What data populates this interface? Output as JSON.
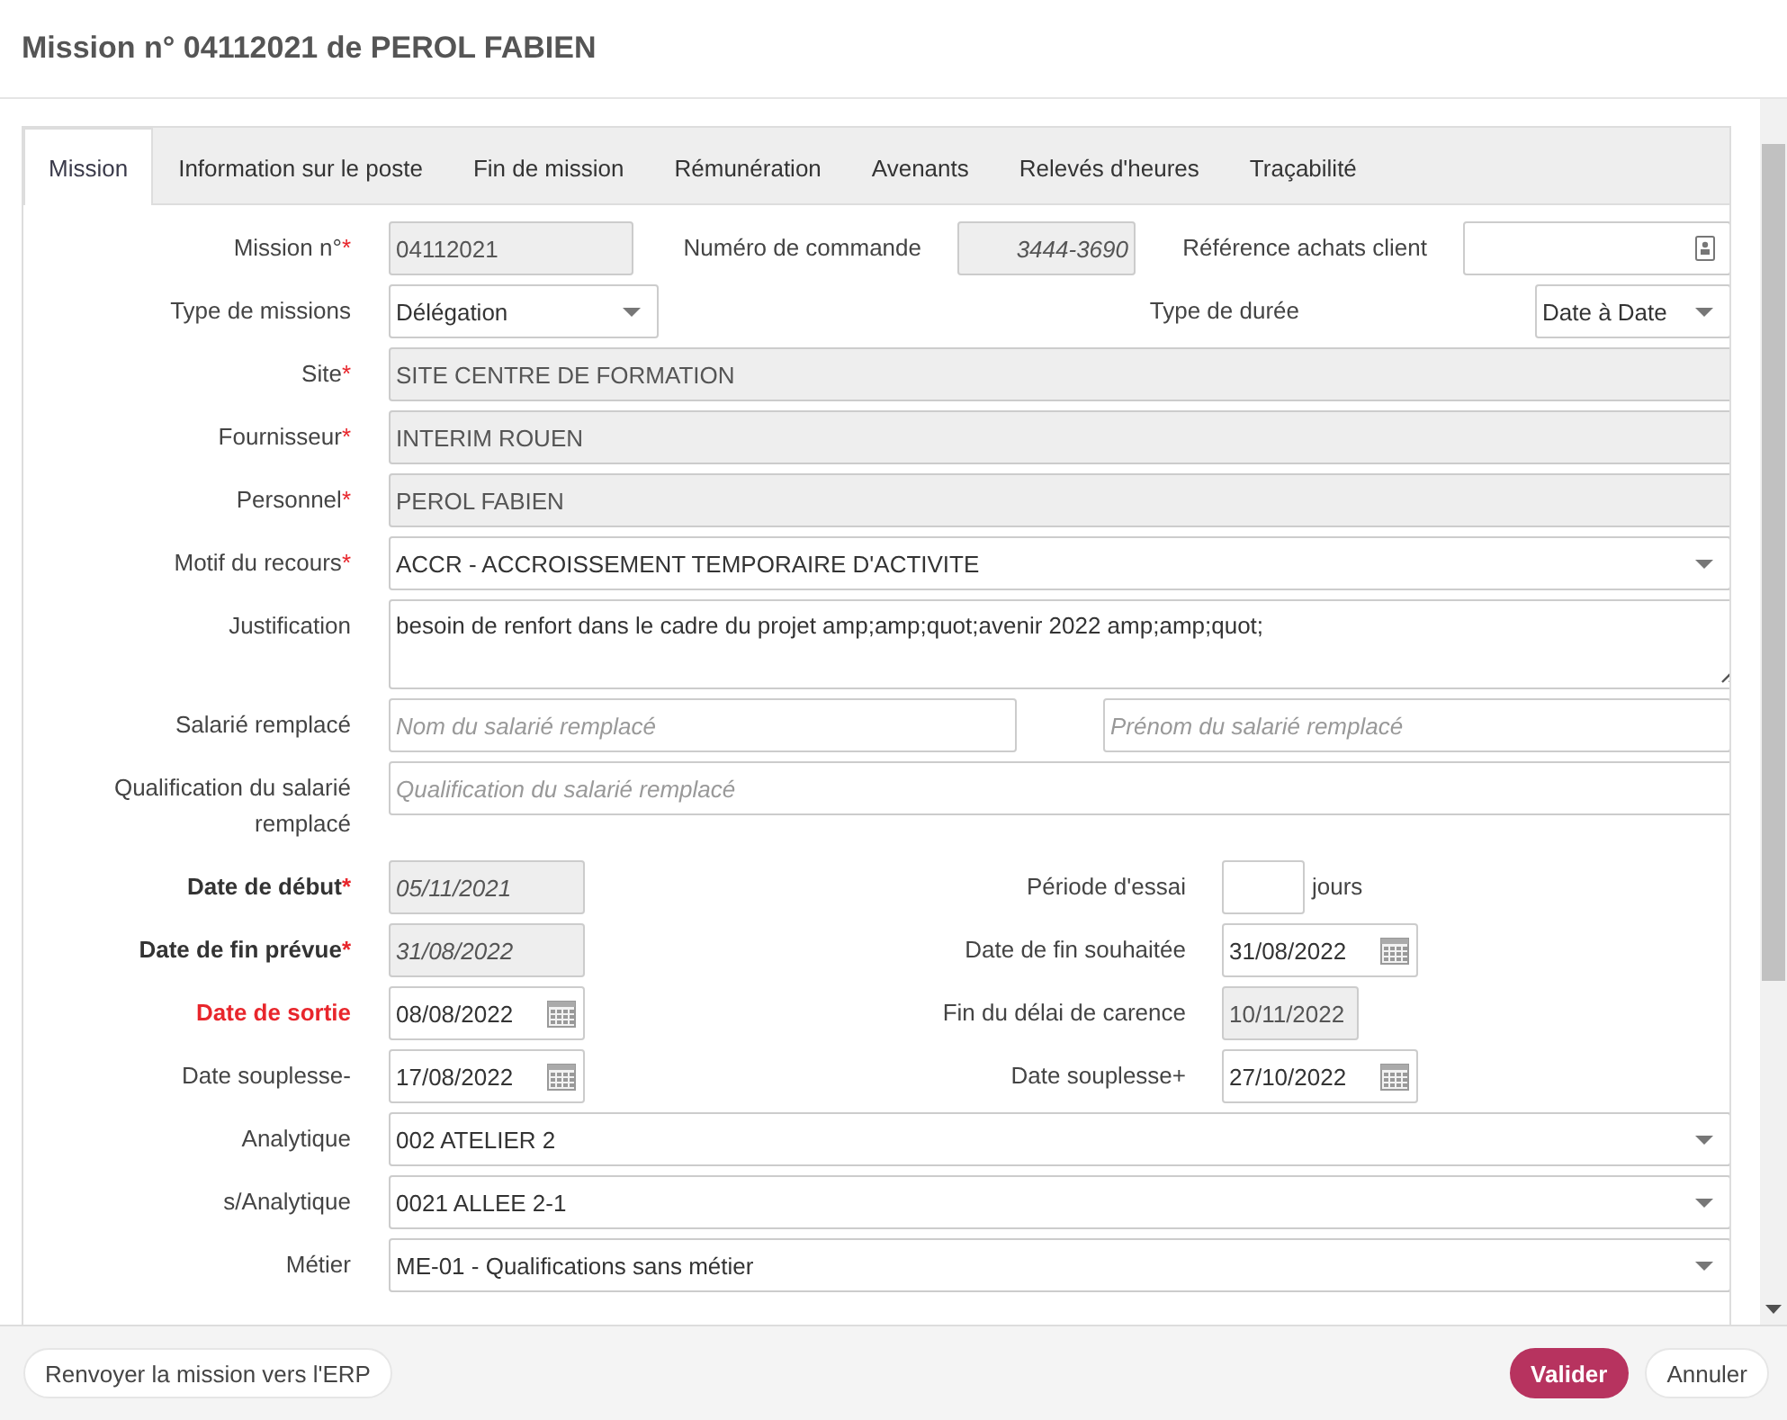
{
  "dialog": {
    "title": "Mission n° 04112021 de PEROL FABIEN"
  },
  "tabs": [
    {
      "label": "Mission",
      "selected": true
    },
    {
      "label": "Information sur le poste",
      "selected": false
    },
    {
      "label": "Fin de mission",
      "selected": false
    },
    {
      "label": "Rémunération",
      "selected": false
    },
    {
      "label": "Avenants",
      "selected": false
    },
    {
      "label": "Relevés d'heures",
      "selected": false
    },
    {
      "label": "Traçabilité",
      "selected": false
    }
  ],
  "form": {
    "rows": [
      {
        "items": [
          {
            "kind": "label",
            "text": "Mission n°",
            "mark": "*"
          },
          {
            "kind": "readonly",
            "value": "04112021"
          },
          {
            "kind": "label",
            "text": "Numéro de commande"
          },
          {
            "kind": "computed",
            "value": "3444-3690"
          },
          {
            "kind": "label",
            "text": "Référence achats client"
          },
          {
            "kind": "lookup"
          }
        ]
      },
      {
        "items": [
          {
            "kind": "label",
            "text": "Type de missions"
          },
          {
            "kind": "select",
            "value": "Délégation"
          },
          {
            "kind": "label",
            "text": "Type de durée"
          },
          {
            "kind": "select",
            "value": "Date à Date"
          }
        ]
      },
      {
        "items": [
          {
            "kind": "label",
            "text": "Site",
            "mark": "*"
          },
          {
            "kind": "readonly",
            "value": "SITE CENTRE DE FORMATION"
          }
        ]
      },
      {
        "items": [
          {
            "kind": "label",
            "text": "Fournisseur",
            "mark": "*"
          },
          {
            "kind": "readonly",
            "value": "INTERIM ROUEN"
          }
        ]
      },
      {
        "items": [
          {
            "kind": "label",
            "text": "Personnel",
            "mark": "*"
          },
          {
            "kind": "readonly",
            "value": "PEROL FABIEN"
          }
        ]
      },
      {
        "items": [
          {
            "kind": "label",
            "text": "Motif du recours",
            "mark": "*"
          },
          {
            "kind": "select",
            "value": "ACCR - ACCROISSEMENT TEMPORAIRE D'ACTIVITE"
          }
        ]
      },
      {
        "items": [
          {
            "kind": "label",
            "text": "Justification"
          },
          {
            "kind": "textarea",
            "value": "besoin de renfort dans le cadre du projet  amp;amp;quot;avenir 2022 amp;amp;quot;"
          }
        ]
      },
      {
        "items": [
          {
            "kind": "label",
            "text": "Salarié remplacé"
          },
          {
            "kind": "text",
            "placeholder": "Nom du salarié remplacé"
          },
          {
            "kind": "text",
            "placeholder": "Prénom du salarié remplacé"
          }
        ]
      },
      {
        "items": [
          {
            "kind": "label",
            "text": "Qualification du salarié remplacé"
          },
          {
            "kind": "text",
            "placeholder": "Qualification du salarié remplacé"
          }
        ]
      },
      {
        "items": [
          {
            "kind": "label",
            "text": "Date de début",
            "mark": "*"
          },
          {
            "kind": "computed",
            "value": "05/11/2021"
          },
          {
            "kind": "label",
            "text": "Période d'essai"
          },
          {
            "kind": "text"
          },
          {
            "kind": "unit",
            "text": "jours"
          }
        ]
      },
      {
        "items": [
          {
            "kind": "label",
            "text": "Date de fin prévue",
            "mark": "*"
          },
          {
            "kind": "computed",
            "value": "31/08/2022"
          },
          {
            "kind": "label",
            "text": "Date de fin souhaitée"
          },
          {
            "kind": "date",
            "value": "31/08/2022"
          }
        ]
      },
      {
        "items": [
          {
            "kind": "label",
            "text": "Date de sortie"
          },
          {
            "kind": "date",
            "value": "08/08/2022"
          },
          {
            "kind": "label",
            "text": "Fin du délai de carence"
          },
          {
            "kind": "readonly",
            "value": "10/11/2022"
          }
        ]
      },
      {
        "items": [
          {
            "kind": "label",
            "text": "Date souplesse-"
          },
          {
            "kind": "date",
            "value": "17/08/2022"
          },
          {
            "kind": "label",
            "text": "Date souplesse+"
          },
          {
            "kind": "date",
            "value": "27/10/2022"
          }
        ]
      },
      {
        "items": [
          {
            "kind": "label",
            "text": "Analytique"
          },
          {
            "kind": "select",
            "value": "002 ATELIER 2"
          }
        ]
      },
      {
        "items": [
          {
            "kind": "label",
            "text": "s/Analytique"
          },
          {
            "kind": "select",
            "value": "0021 ALLEE 2-1"
          }
        ]
      },
      {
        "items": [
          {
            "kind": "label",
            "text": "Métier"
          },
          {
            "kind": "select",
            "value": "ME-01 - Qualifications sans métier"
          }
        ]
      }
    ]
  },
  "footer": {
    "buttons": [
      {
        "label": "Renvoyer la mission vers l'ERP",
        "kind": "secondary"
      },
      {
        "label": "Valider",
        "kind": "primary"
      },
      {
        "label": "Annuler",
        "kind": "secondary"
      }
    ]
  }
}
